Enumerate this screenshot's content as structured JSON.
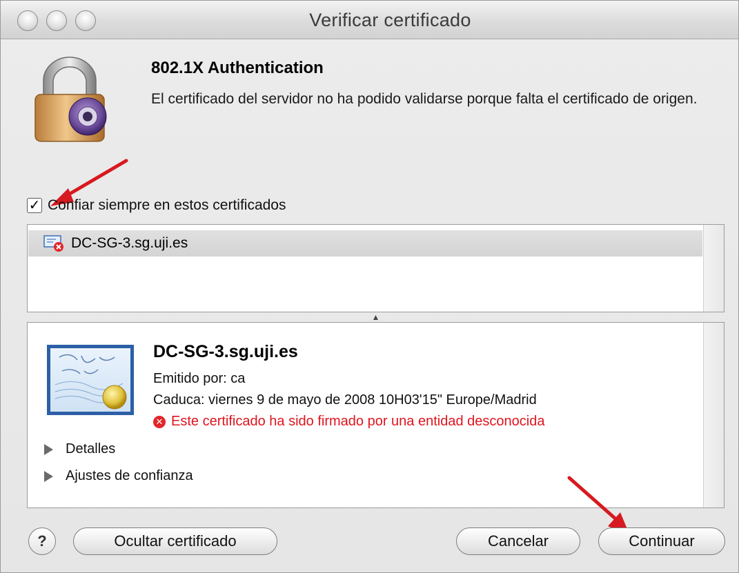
{
  "window": {
    "title": "Verificar certificado"
  },
  "header": {
    "heading": "802.1X Authentication",
    "message": "El certificado del servidor no ha podido validarse porque falta el certificado de origen."
  },
  "trust_option": {
    "label": "Confiar siempre en estos certificados",
    "checked": true
  },
  "cert_list": {
    "items": [
      {
        "label": "DC-SG-3.sg.uji.es",
        "selected": true
      }
    ]
  },
  "cert_detail": {
    "name": "DC-SG-3.sg.uji.es",
    "issued_by": "Emitido por: ca",
    "expires": "Caduca: viernes 9 de mayo de 2008 10H03'15\" Europe/Madrid",
    "error": "Este certificado ha sido firmado por una entidad desconocida",
    "sections": [
      {
        "label": "Detalles"
      },
      {
        "label": "Ajustes de confianza"
      }
    ]
  },
  "buttons": {
    "help_label": "?",
    "hide_cert_label": "Ocultar certificado",
    "cancel_label": "Cancelar",
    "continue_label": "Continuar"
  },
  "colors": {
    "error_red": "#e0141e",
    "annotation_arrow": "#d71920",
    "selection_gray": "#d4d4d4"
  }
}
